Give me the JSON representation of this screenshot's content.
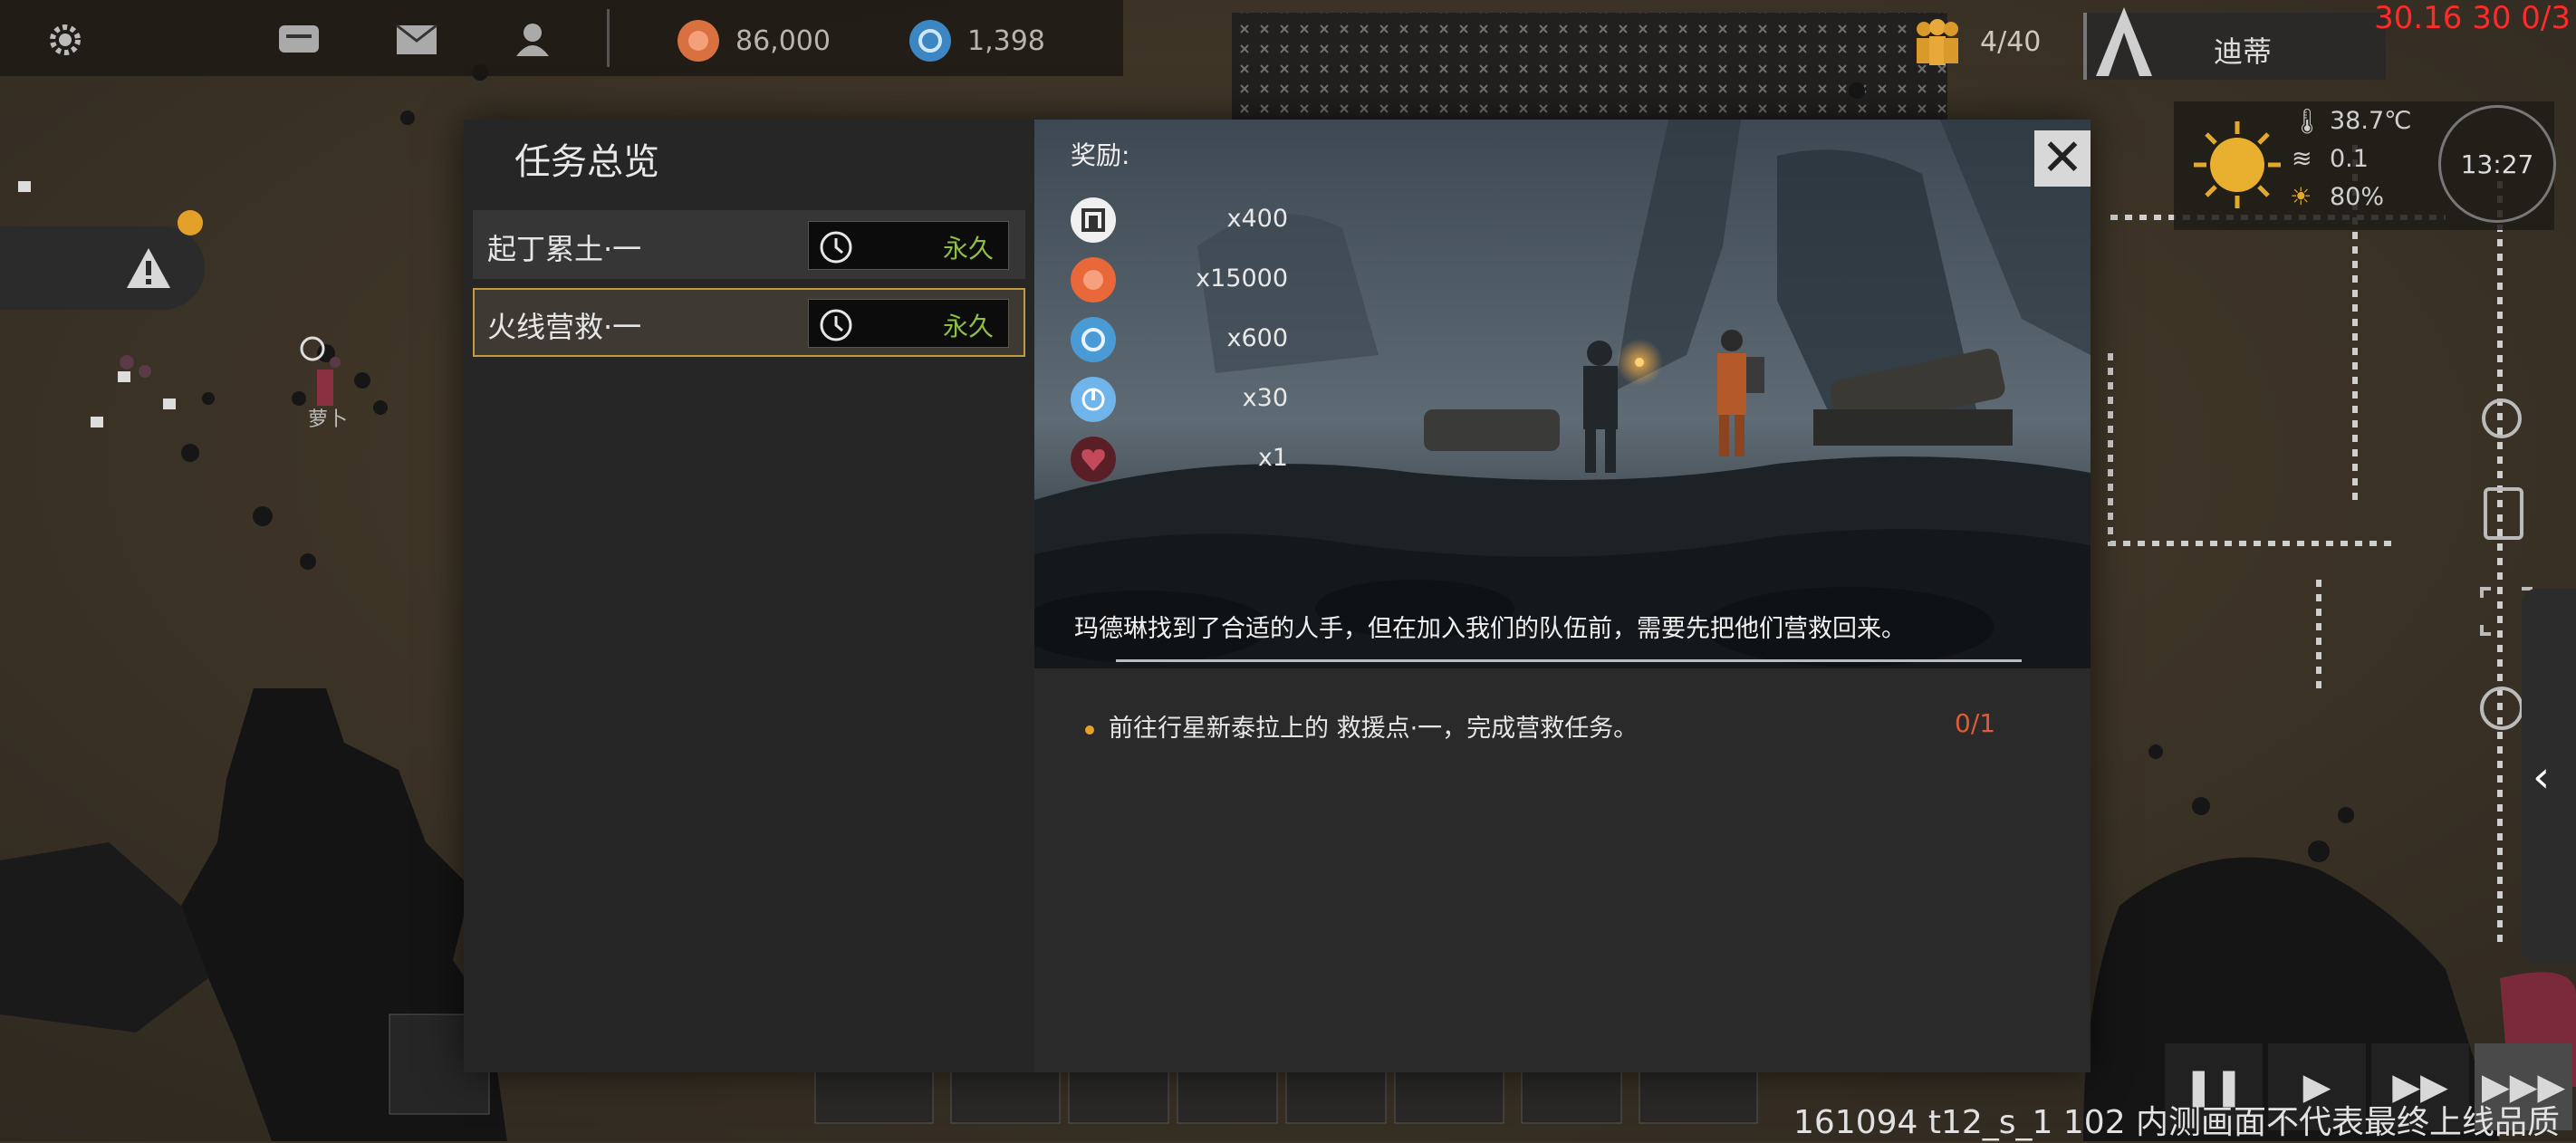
{
  "hud": {
    "gold": "86,000",
    "tech": "1,398",
    "population": "4/40",
    "character_name": "迪蒂",
    "debug_overlay": "30.16 30 0/3",
    "temperature": "38.7℃",
    "wind": "0.1",
    "humidity": "80%",
    "time": "13:27"
  },
  "map_label": "萝卜",
  "modal": {
    "title": "任务总览",
    "missions": [
      {
        "name": "起丁累土·一",
        "duration": "永久"
      },
      {
        "name": "火线营救·一",
        "duration": "永久"
      }
    ],
    "rewards_label": "奖励:",
    "rewards": [
      {
        "icon": "building-token-icon",
        "amount": "x400"
      },
      {
        "icon": "gold-coin-icon",
        "amount": "x15000"
      },
      {
        "icon": "tech-chip-icon",
        "amount": "x600"
      },
      {
        "icon": "power-token-icon",
        "amount": "x30"
      },
      {
        "icon": "heart-organ-icon",
        "amount": "x1"
      }
    ],
    "caption": "玛德琳找到了合适的人手，但在加入我们的队伍前，需要先把他们营救回来。",
    "objective": "前往行星新泰拉上的 救援点·一，完成营救任务。",
    "progress": "0/1"
  },
  "footer": {
    "watermark": "161094 t12_s_1 102  内测画面不代表最终上线品质"
  },
  "colors": {
    "accent_gold": "#c49a41",
    "duration_green": "#8fbf3f",
    "progress_red": "#e05a3a",
    "debug_red": "#ff2a2a"
  }
}
